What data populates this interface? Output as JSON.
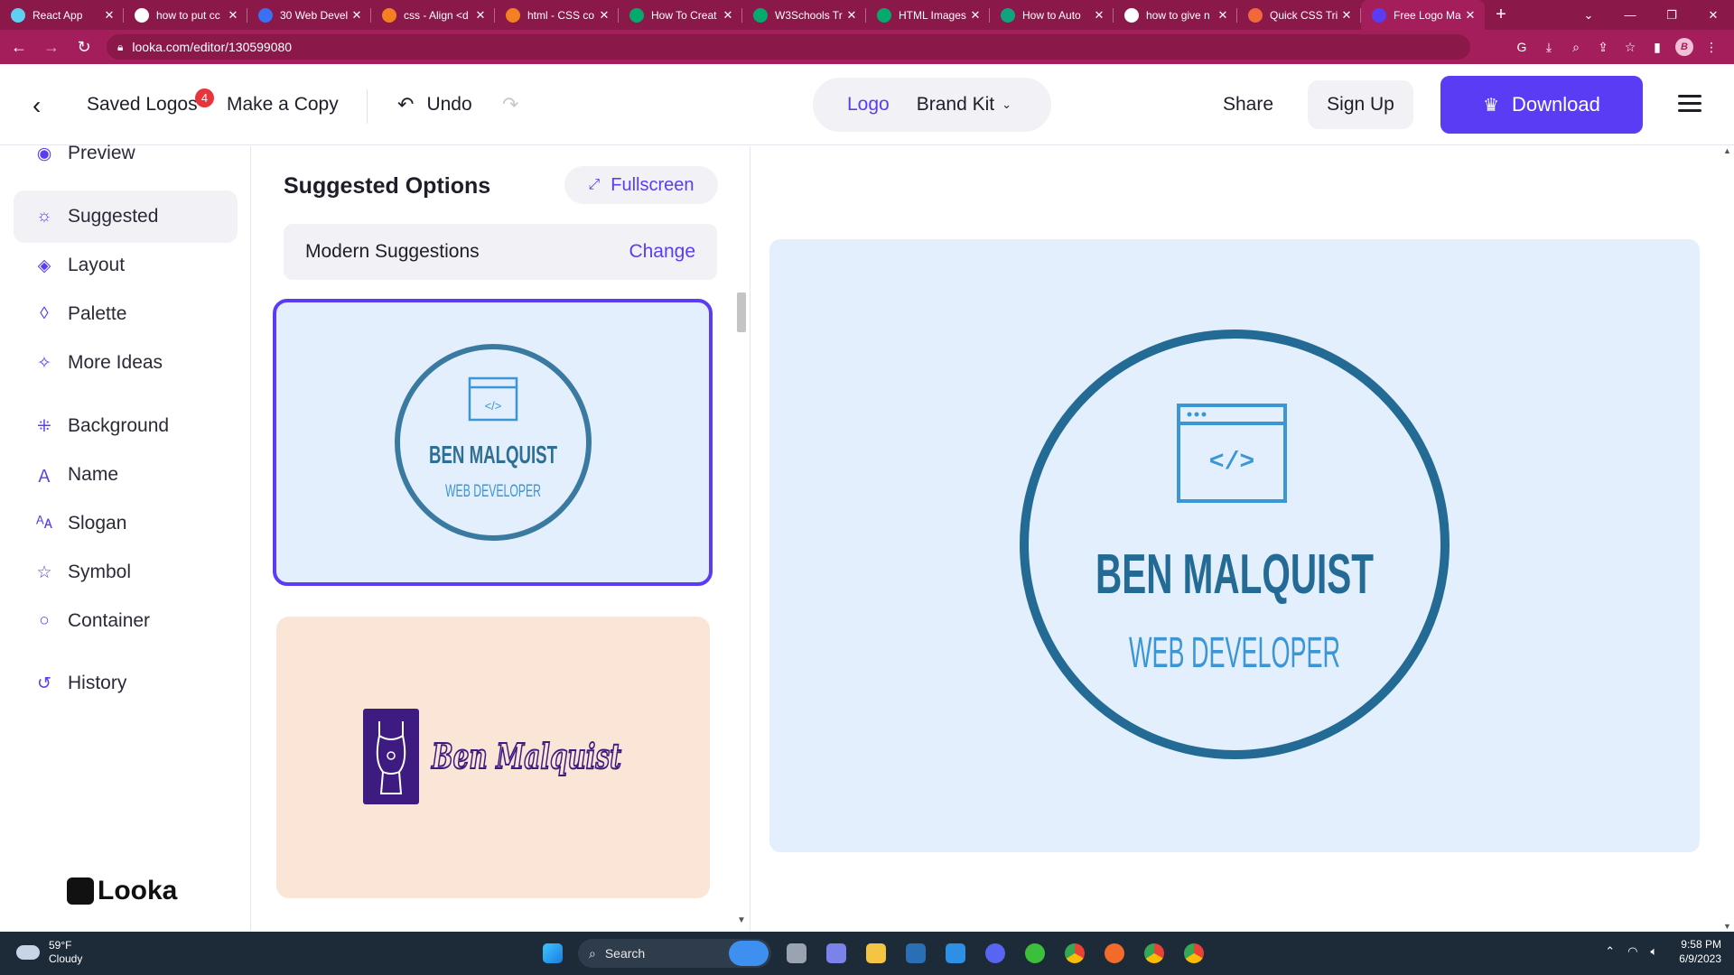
{
  "browser": {
    "tabs": [
      {
        "title": "React App",
        "favicon_color": "#5fd0f2",
        "active": false
      },
      {
        "title": "how to put cc",
        "favicon_color": "#ffffff",
        "active": false
      },
      {
        "title": "30 Web Devel",
        "favicon_color": "#3b6ff5",
        "active": false
      },
      {
        "title": "css - Align <d",
        "favicon_color": "#f48024",
        "active": false
      },
      {
        "title": "html - CSS co",
        "favicon_color": "#f48024",
        "active": false
      },
      {
        "title": "How To Creat",
        "favicon_color": "#04aa6d",
        "active": false
      },
      {
        "title": "W3Schools Tr",
        "favicon_color": "#04aa6d",
        "active": false
      },
      {
        "title": "HTML Images",
        "favicon_color": "#04aa6d",
        "active": false
      },
      {
        "title": "How to Auto",
        "favicon_color": "#10a37f",
        "active": false
      },
      {
        "title": "how to give n",
        "favicon_color": "#ffffff",
        "active": false
      },
      {
        "title": "Quick CSS Tri",
        "favicon_color": "#f1683a",
        "active": false
      },
      {
        "title": "Free Logo Ma",
        "favicon_color": "#5b3cf5",
        "active": true
      }
    ],
    "url": "looka.com/editor/130599080",
    "profile_initial": "B",
    "accent": "#a51e5c"
  },
  "header": {
    "saved_logos": "Saved Logos",
    "saved_badge": "4",
    "make_copy": "Make a Copy",
    "undo": "Undo",
    "toggle_logo": "Logo",
    "toggle_brand_kit": "Brand Kit",
    "share": "Share",
    "sign_up": "Sign Up",
    "download": "Download",
    "primary_color": "#5b3cf5"
  },
  "sidebar": {
    "items": [
      {
        "label": "Preview",
        "icon": "eye-icon",
        "glyph": "◉"
      },
      {
        "label": "Suggested",
        "icon": "lightbulb-icon",
        "glyph": "☼"
      },
      {
        "label": "Layout",
        "icon": "layers-icon",
        "glyph": "◈"
      },
      {
        "label": "Palette",
        "icon": "droplet-icon",
        "glyph": "◊"
      },
      {
        "label": "More Ideas",
        "icon": "magic-wand-icon",
        "glyph": "✧"
      },
      {
        "label": "Background",
        "icon": "background-icon",
        "glyph": "⁜"
      },
      {
        "label": "Name",
        "icon": "text-icon",
        "glyph": "Ａ"
      },
      {
        "label": "Slogan",
        "icon": "slogan-icon",
        "glyph": "ᴬᴀ"
      },
      {
        "label": "Symbol",
        "icon": "star-icon",
        "glyph": "☆"
      },
      {
        "label": "Container",
        "icon": "circle-icon",
        "glyph": "○"
      },
      {
        "label": "History",
        "icon": "history-icon",
        "glyph": "↺"
      }
    ],
    "active_index": 1,
    "brand": "Looka"
  },
  "suggestions": {
    "title": "Suggested Options",
    "fullscreen": "Fullscreen",
    "category": "Modern Suggestions",
    "change": "Change",
    "card1": {
      "name": "BEN MALQUIST",
      "slogan": "WEB DEVELOPER",
      "bg": "#e3effc",
      "ring": "#3a7aa0"
    },
    "card2": {
      "name": "Ben Malquist",
      "bg": "#fae5d6",
      "accent": "#3d1b80"
    }
  },
  "preview": {
    "name": "BEN MALQUIST",
    "slogan": "WEB DEVELOPER",
    "code_symbol": "</>",
    "bg": "#e3effc",
    "ring_color": "#236a95",
    "name_color": "#236a95",
    "slogan_color": "#3a96d4"
  },
  "taskbar": {
    "temperature": "59°F",
    "condition": "Cloudy",
    "search": "Search",
    "time": "9:58 PM",
    "date": "6/9/2023"
  }
}
